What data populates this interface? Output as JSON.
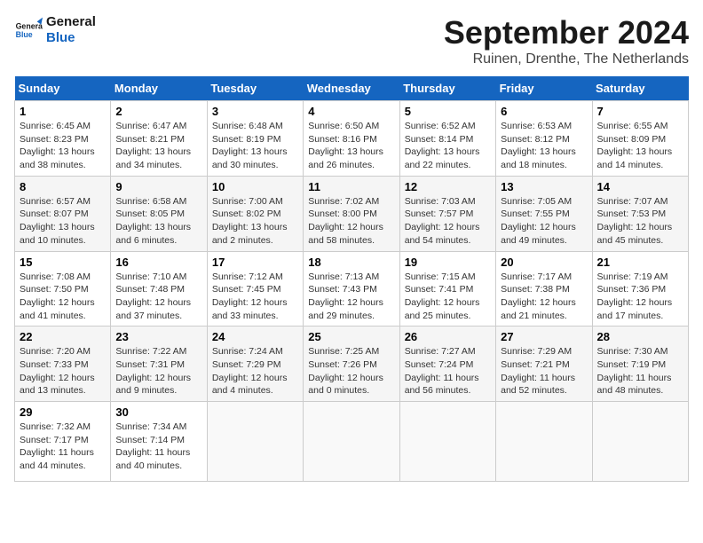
{
  "header": {
    "logo_line1": "General",
    "logo_line2": "Blue",
    "month": "September 2024",
    "location": "Ruinen, Drenthe, The Netherlands"
  },
  "calendar": {
    "days_of_week": [
      "Sunday",
      "Monday",
      "Tuesday",
      "Wednesday",
      "Thursday",
      "Friday",
      "Saturday"
    ],
    "weeks": [
      [
        {
          "day": "",
          "detail": ""
        },
        {
          "day": "2",
          "detail": "Sunrise: 6:47 AM\nSunset: 8:21 PM\nDaylight: 13 hours\nand 34 minutes."
        },
        {
          "day": "3",
          "detail": "Sunrise: 6:48 AM\nSunset: 8:19 PM\nDaylight: 13 hours\nand 30 minutes."
        },
        {
          "day": "4",
          "detail": "Sunrise: 6:50 AM\nSunset: 8:16 PM\nDaylight: 13 hours\nand 26 minutes."
        },
        {
          "day": "5",
          "detail": "Sunrise: 6:52 AM\nSunset: 8:14 PM\nDaylight: 13 hours\nand 22 minutes."
        },
        {
          "day": "6",
          "detail": "Sunrise: 6:53 AM\nSunset: 8:12 PM\nDaylight: 13 hours\nand 18 minutes."
        },
        {
          "day": "7",
          "detail": "Sunrise: 6:55 AM\nSunset: 8:09 PM\nDaylight: 13 hours\nand 14 minutes."
        }
      ],
      [
        {
          "day": "8",
          "detail": "Sunrise: 6:57 AM\nSunset: 8:07 PM\nDaylight: 13 hours\nand 10 minutes."
        },
        {
          "day": "9",
          "detail": "Sunrise: 6:58 AM\nSunset: 8:05 PM\nDaylight: 13 hours\nand 6 minutes."
        },
        {
          "day": "10",
          "detail": "Sunrise: 7:00 AM\nSunset: 8:02 PM\nDaylight: 13 hours\nand 2 minutes."
        },
        {
          "day": "11",
          "detail": "Sunrise: 7:02 AM\nSunset: 8:00 PM\nDaylight: 12 hours\nand 58 minutes."
        },
        {
          "day": "12",
          "detail": "Sunrise: 7:03 AM\nSunset: 7:57 PM\nDaylight: 12 hours\nand 54 minutes."
        },
        {
          "day": "13",
          "detail": "Sunrise: 7:05 AM\nSunset: 7:55 PM\nDaylight: 12 hours\nand 49 minutes."
        },
        {
          "day": "14",
          "detail": "Sunrise: 7:07 AM\nSunset: 7:53 PM\nDaylight: 12 hours\nand 45 minutes."
        }
      ],
      [
        {
          "day": "15",
          "detail": "Sunrise: 7:08 AM\nSunset: 7:50 PM\nDaylight: 12 hours\nand 41 minutes."
        },
        {
          "day": "16",
          "detail": "Sunrise: 7:10 AM\nSunset: 7:48 PM\nDaylight: 12 hours\nand 37 minutes."
        },
        {
          "day": "17",
          "detail": "Sunrise: 7:12 AM\nSunset: 7:45 PM\nDaylight: 12 hours\nand 33 minutes."
        },
        {
          "day": "18",
          "detail": "Sunrise: 7:13 AM\nSunset: 7:43 PM\nDaylight: 12 hours\nand 29 minutes."
        },
        {
          "day": "19",
          "detail": "Sunrise: 7:15 AM\nSunset: 7:41 PM\nDaylight: 12 hours\nand 25 minutes."
        },
        {
          "day": "20",
          "detail": "Sunrise: 7:17 AM\nSunset: 7:38 PM\nDaylight: 12 hours\nand 21 minutes."
        },
        {
          "day": "21",
          "detail": "Sunrise: 7:19 AM\nSunset: 7:36 PM\nDaylight: 12 hours\nand 17 minutes."
        }
      ],
      [
        {
          "day": "22",
          "detail": "Sunrise: 7:20 AM\nSunset: 7:33 PM\nDaylight: 12 hours\nand 13 minutes."
        },
        {
          "day": "23",
          "detail": "Sunrise: 7:22 AM\nSunset: 7:31 PM\nDaylight: 12 hours\nand 9 minutes."
        },
        {
          "day": "24",
          "detail": "Sunrise: 7:24 AM\nSunset: 7:29 PM\nDaylight: 12 hours\nand 4 minutes."
        },
        {
          "day": "25",
          "detail": "Sunrise: 7:25 AM\nSunset: 7:26 PM\nDaylight: 12 hours\nand 0 minutes."
        },
        {
          "day": "26",
          "detail": "Sunrise: 7:27 AM\nSunset: 7:24 PM\nDaylight: 11 hours\nand 56 minutes."
        },
        {
          "day": "27",
          "detail": "Sunrise: 7:29 AM\nSunset: 7:21 PM\nDaylight: 11 hours\nand 52 minutes."
        },
        {
          "day": "28",
          "detail": "Sunrise: 7:30 AM\nSunset: 7:19 PM\nDaylight: 11 hours\nand 48 minutes."
        }
      ],
      [
        {
          "day": "29",
          "detail": "Sunrise: 7:32 AM\nSunset: 7:17 PM\nDaylight: 11 hours\nand 44 minutes."
        },
        {
          "day": "30",
          "detail": "Sunrise: 7:34 AM\nSunset: 7:14 PM\nDaylight: 11 hours\nand 40 minutes."
        },
        {
          "day": "",
          "detail": ""
        },
        {
          "day": "",
          "detail": ""
        },
        {
          "day": "",
          "detail": ""
        },
        {
          "day": "",
          "detail": ""
        },
        {
          "day": "",
          "detail": ""
        }
      ]
    ],
    "week1_day1": {
      "day": "1",
      "detail": "Sunrise: 6:45 AM\nSunset: 8:23 PM\nDaylight: 13 hours\nand 38 minutes."
    }
  }
}
